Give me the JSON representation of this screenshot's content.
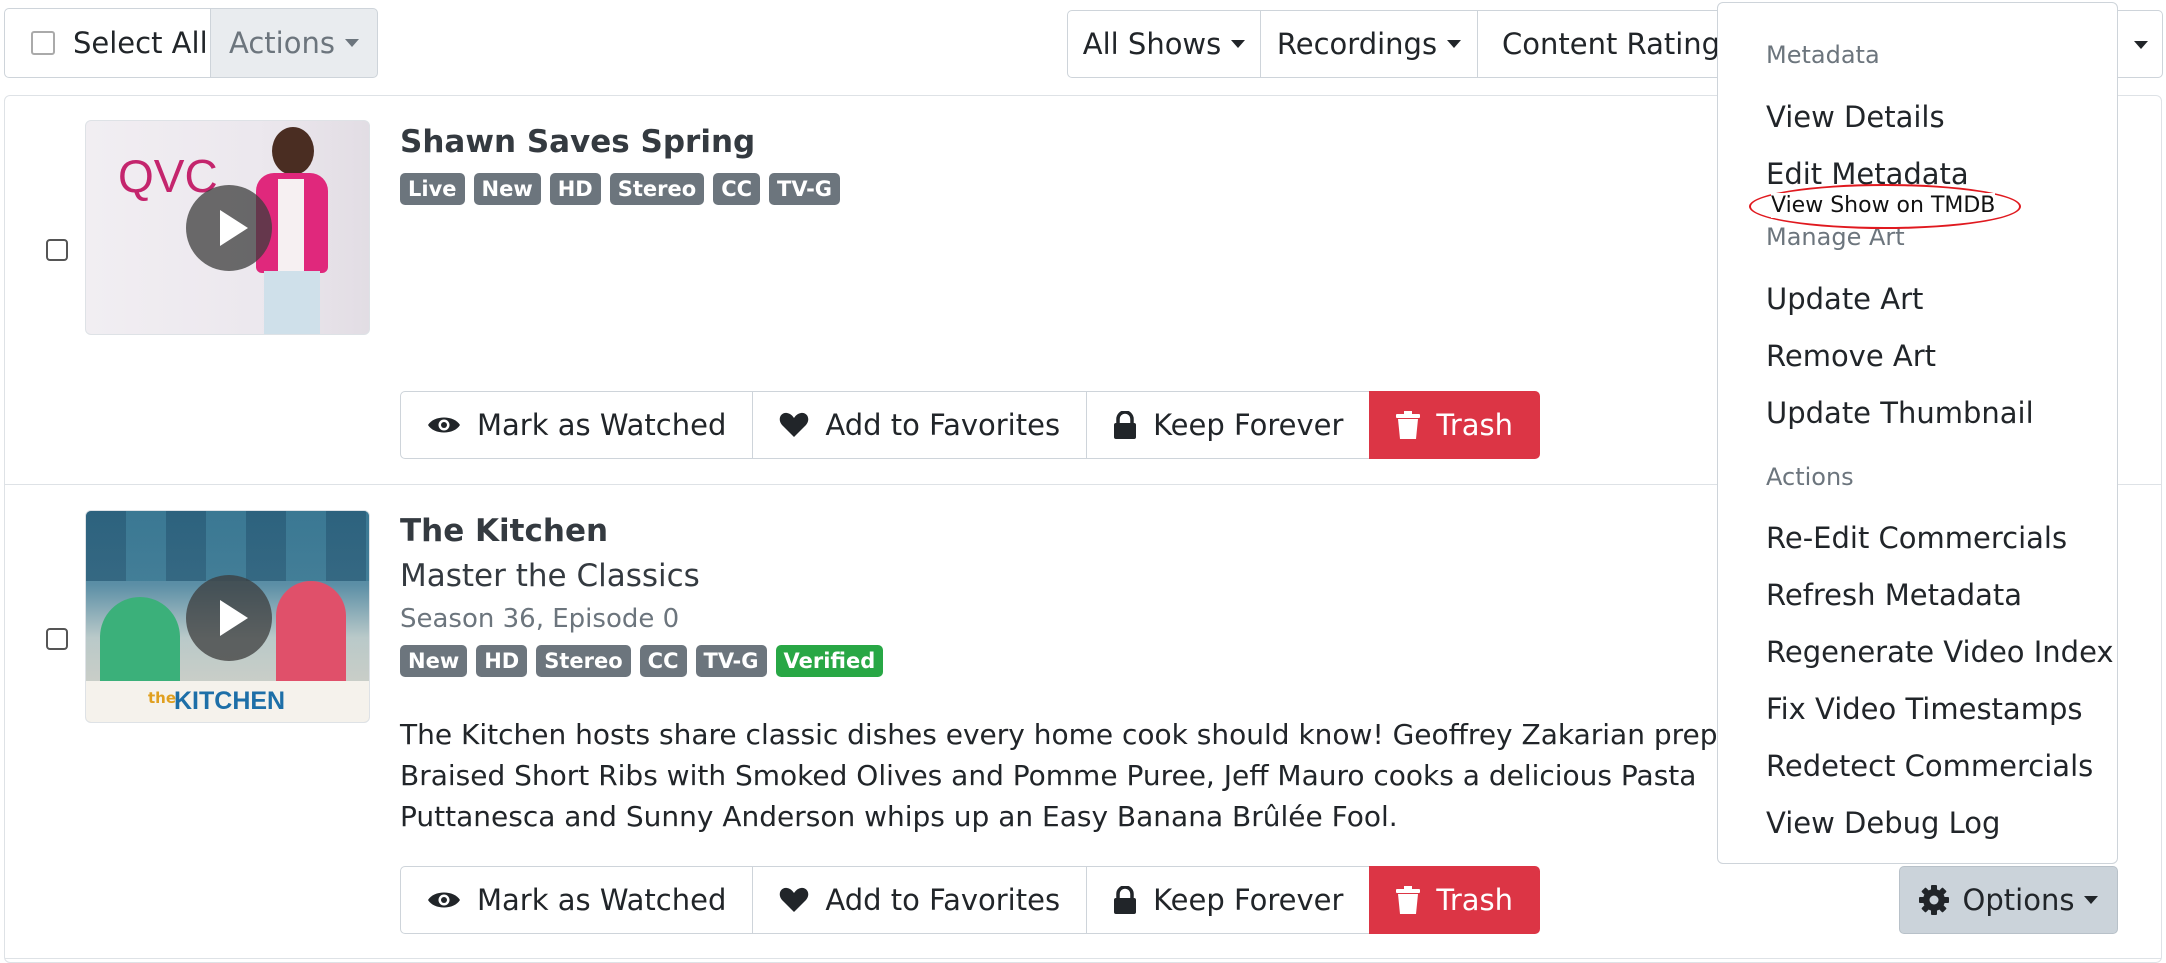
{
  "toolbar": {
    "select_all": "Select All",
    "actions": "Actions",
    "all_shows": "All Shows",
    "recordings": "Recordings",
    "content_rating": "Content Rating"
  },
  "items": [
    {
      "title": "Shawn Saves Spring",
      "thumb_text": "QVC",
      "badges": [
        "Live",
        "New",
        "HD",
        "Stereo",
        "CC",
        "TV-G"
      ],
      "actions": {
        "watched": "Mark as Watched",
        "favorites": "Add to Favorites",
        "keep": "Keep Forever",
        "trash": "Trash"
      }
    },
    {
      "title": "The Kitchen",
      "subtitle": "Master the Classics",
      "episode": "Season 36, Episode 0",
      "thumb_text": "KITCHEN",
      "thumb_small": "the",
      "badges": [
        "New",
        "HD",
        "Stereo",
        "CC",
        "TV-G"
      ],
      "verified": "Verified",
      "description_lines": [
        "The Kitchen hosts share classic dishes every home cook should know! Geoffrey Zakarian prepares",
        "Braised Short Ribs with Smoked Olives and Pomme Puree, Jeff Mauro cooks a delicious Pasta",
        "Puttanesca and Sunny Anderson whips up an Easy Banana Brûlée Fool."
      ],
      "actions": {
        "watched": "Mark as Watched",
        "favorites": "Add to Favorites",
        "keep": "Keep Forever",
        "trash": "Trash"
      },
      "options": "Options"
    }
  ],
  "menu": {
    "metadata_header": "Metadata",
    "view_details": "View Details",
    "edit_metadata": "Edit Metadata",
    "view_tmdb": "View Show on TMDB",
    "manage_art_header": "Manage Art",
    "update_art": "Update Art",
    "remove_art": "Remove Art",
    "update_thumbnail": "Update Thumbnail",
    "actions_header": "Actions",
    "re_edit": "Re-Edit Commercials",
    "refresh": "Refresh Metadata",
    "regenerate": "Regenerate Video Index",
    "fix_timestamps": "Fix Video Timestamps",
    "redetect": "Redetect Commercials",
    "debug_log": "View Debug Log"
  },
  "colors": {
    "trash": "#dc3545",
    "verified": "#28a745",
    "badge": "#6c757d",
    "annotation": "#e0191f"
  }
}
